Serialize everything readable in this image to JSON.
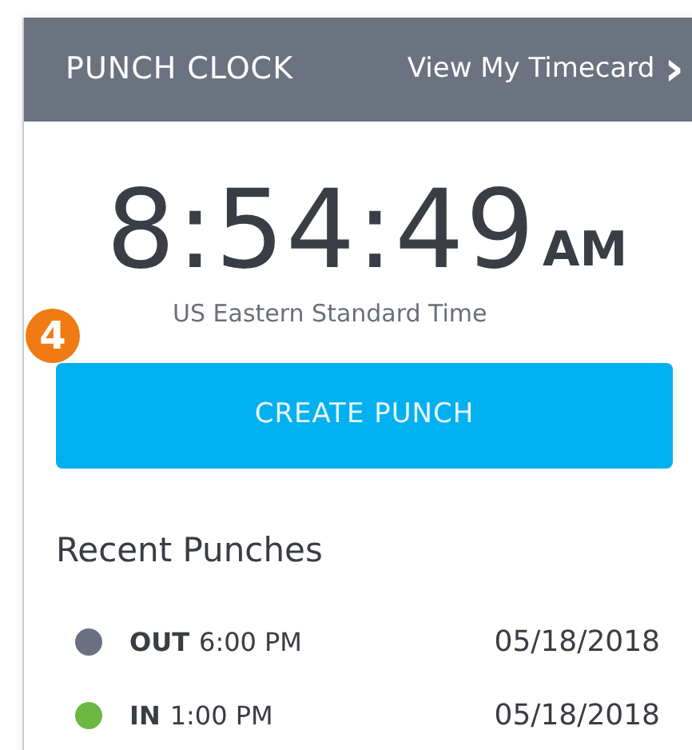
{
  "header": {
    "title": "PUNCH CLOCK",
    "link": "View My Timecard",
    "link_icon": "›"
  },
  "clock": {
    "time": "8:54:49",
    "meridiem": "AM",
    "zone": "US Eastern Standard Time"
  },
  "step_badge": "4",
  "create_button": "CREATE PUNCH",
  "recent": {
    "title": "Recent Punches",
    "punches": [
      {
        "type": "OUT",
        "time": "6:00 PM",
        "date": "05/18/2018",
        "color": "#6b7080"
      },
      {
        "type": "IN",
        "time": "1:00 PM",
        "date": "05/18/2018",
        "color": "#6bb843"
      }
    ]
  }
}
